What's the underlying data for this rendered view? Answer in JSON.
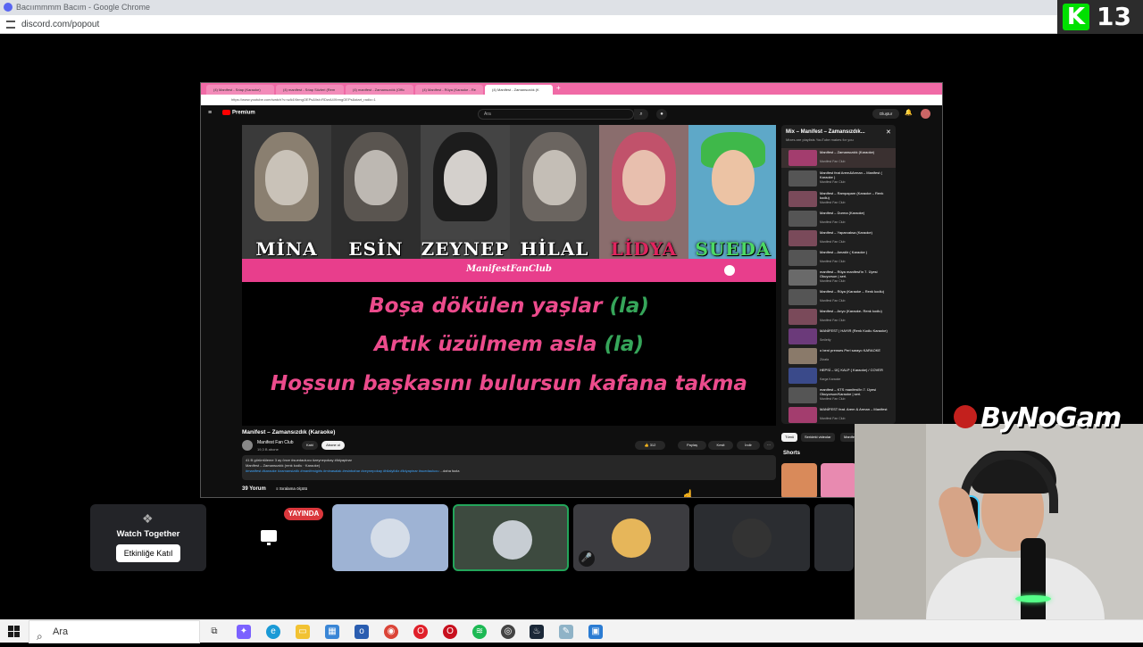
{
  "outer_window": {
    "title": "Bacıımmmm Bacım - Google Chrome",
    "url": "discord.com/popout"
  },
  "badge": {
    "letter": "K",
    "number": "13"
  },
  "shared_browser": {
    "tabs": [
      "(4) Manifest - Sıtap (Karaoke)",
      "(4) manifest - Sıtap Sözleri (Rem",
      "(4) manifest - Zamansızdık (Offic",
      "(4) Manifest - Rüya (Karaoke - Re",
      "(4) Manifest - Zamansızdık (K"
    ],
    "active_tab_index": 4,
    "url": "https://www.youtube.com/watch?v=wA4XbmgOEPs&list=RDwA4XbmgOEPs&start_radio=1",
    "youtube": {
      "logo": "Premium",
      "search_placeholder": "Ara",
      "create_label": "Oluştur"
    },
    "video": {
      "members": [
        "MİNA",
        "ESİN",
        "ZEYNEP",
        "HİLAL",
        "LİDYA",
        "SUEDA"
      ],
      "member_colors": [
        "#ffffff",
        "#ffffff",
        "#ffffff",
        "#ffffff",
        "#e0245e",
        "#4cd964"
      ],
      "club_banner": "ManifestFanClub",
      "lyrics": [
        {
          "text": "Boşa dökülen yaşlar ",
          "la": "(la)"
        },
        {
          "text": "Artık üzülmem asla ",
          "la": "(la)"
        },
        {
          "text": "Hoşsun başkasını bulursun kafana takma",
          "la": ""
        }
      ]
    },
    "video_title": "Manifest – Zamansızdık (Karaoke)",
    "channel": {
      "name": "Manifest Fan Club",
      "subs": "19,3 B abone"
    },
    "join_label": "Katıl",
    "subscribe_label": "Abone ol",
    "likes": "312",
    "share_label": "Paylaş",
    "clip_label": "Kesit",
    "download_label": "İndir",
    "description": {
      "stats": "41 B görüntüleme  3 ay önce  #suedaulucu #zeynepokay #lidyapinar",
      "line2": "Manifest – Zamansızdık (renk kodlu · Karaoke)",
      "tags": "#manifest #karaoke #zamansizdik #manifestgirls #minasalak #esinbahar #zeynepokay #hilalyildiz #lidyapinar #suedaulucu",
      "more": "...daha fazla"
    },
    "comments": "39 Yorum",
    "sort_label": "Sıralama ölçütü",
    "playlist": {
      "title": "Mix – Manifest – Zamansızdık...",
      "subtitle": "Mixes are playlists YouTube makes for you",
      "items": [
        {
          "title": "Manifest – Zamansızdık (Karaoke)",
          "channel": "Manifest Fan Club"
        },
        {
          "title": "Manifest feat Arem&Arman – Manifest ( Karaoke )",
          "channel": "Manifest Fan Club"
        },
        {
          "title": "Manifest – Rampapam (Karaoke – Renk kodlu)",
          "channel": "Manifest Fan Club"
        },
        {
          "title": "Manifest – Durma (Karaoke)",
          "channel": "Manifest Fan Club"
        },
        {
          "title": "Manifest – Yaparcaksa (Karaoke)",
          "channel": "Manifest Fan Club"
        },
        {
          "title": "Manifest – Amatör ( Karaoke )",
          "channel": "Manifest Fan Club"
        },
        {
          "title": "manifest – Rüya manifest'in 7. Üyesi Okuyorsun | seri.",
          "channel": "Manifest Fan Club"
        },
        {
          "title": "Manifest – Rüya (Karaoke – Renk kodlu)",
          "channel": "Manifest Fan Club"
        },
        {
          "title": "Manifest – Arıyo (Karaoke- Renk kodlu)",
          "channel": "Manifest Fan Club"
        },
        {
          "title": "MANİFEST | HAYIR (Renk Kodlu Karaoke)",
          "channel": "Smiletty"
        },
        {
          "title": "o beni prenses Peri sarayo KARAOKE",
          "channel": "Zürafa"
        },
        {
          "title": "HEPSİ – ÜÇ KALP ( Karaoke) / COVER",
          "channel": "Karga Karaoke"
        },
        {
          "title": "manifest – KTS manifest'in 7. Üyesi Okuyorsun/Karaoke | seri.",
          "channel": "Manifest Fan Club"
        },
        {
          "title": "MANİFEST feat. Arem & Arman – Manifest",
          "channel": "Manifest Fan Club"
        }
      ]
    },
    "chips": [
      "Tümü",
      "Serideki videolar",
      "Manifest"
    ],
    "shorts_label": "Shorts"
  },
  "discord": {
    "watch_together": "Watch Together",
    "join_activity": "Etkinliğe Katıl",
    "live_badge": "YAYINDA"
  },
  "brand": "ByNoGam",
  "taskbar": {
    "search_label": "Ara"
  }
}
